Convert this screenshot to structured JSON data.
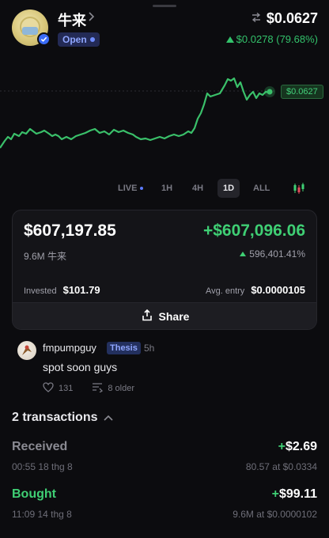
{
  "token": {
    "name": "牛来",
    "status": "Open",
    "price": "$0.0627",
    "change": "$0.0278 (79.68%)"
  },
  "chart": {
    "price_tag": "$0.0627",
    "timeframes": [
      {
        "label": "LIVE",
        "active": false
      },
      {
        "label": "1H",
        "active": false
      },
      {
        "label": "4H",
        "active": false
      },
      {
        "label": "1D",
        "active": true
      },
      {
        "label": "ALL",
        "active": false
      }
    ]
  },
  "position": {
    "value": "$607,197.85",
    "pnl": "+$607,096.06",
    "holding": "9.6M 牛来",
    "pnl_pct": "596,401.41%",
    "invested_label": "Invested",
    "invested_value": "$101.79",
    "avg_entry_label": "Avg. entry",
    "avg_entry_value": "$0.0000105",
    "share_label": "Share"
  },
  "comment": {
    "user": "fmpumpguy",
    "badge": "Thesis",
    "time": "5h",
    "text": "spot soon guys",
    "likes": "131",
    "older": "8 older"
  },
  "transactions": {
    "header": "2 transactions",
    "items": [
      {
        "type": "Received",
        "amount": "$2.69",
        "date": "00:55 18 thg 8",
        "detail": "80.57 at $0.0334"
      },
      {
        "type": "Bought",
        "amount": "$99.11",
        "date": "11:09 14 thg 8",
        "detail": "9.6M at $0.0000102"
      }
    ]
  },
  "colors": {
    "positive": "#3fcf74",
    "received": "#8a8a92",
    "accent_blue": "#3b6cf6"
  }
}
